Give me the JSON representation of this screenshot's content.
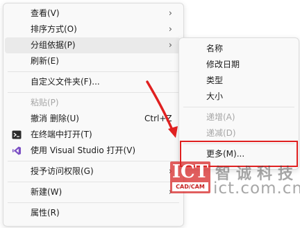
{
  "context_menu": {
    "items": [
      {
        "label": "查看(V)",
        "submenu": true
      },
      {
        "label": "排序方式(O)",
        "submenu": true
      },
      {
        "label": "分组依据(P)",
        "submenu": true,
        "highlighted": true
      },
      {
        "label": "刷新(E)"
      },
      {
        "label": "自定义文件夹(F)..."
      },
      {
        "label": "粘贴(P)",
        "disabled": true
      },
      {
        "label": "撤消 删除(U)",
        "shortcut": "Ctrl+Z"
      },
      {
        "label": "在终端中打开(T)",
        "icon": "terminal-icon"
      },
      {
        "label": "使用 Visual Studio 打开(V)",
        "icon": "visual-studio-icon"
      },
      {
        "label": "授予访问权限(G)",
        "submenu": true
      },
      {
        "label": "新建(W)",
        "submenu": true
      },
      {
        "label": "属性(R)"
      }
    ]
  },
  "group_by_submenu": {
    "items": [
      {
        "label": "名称"
      },
      {
        "label": "修改日期"
      },
      {
        "label": "类型"
      },
      {
        "label": "大小"
      },
      {
        "label": "递增(A)",
        "disabled": true
      },
      {
        "label": "递减(D)",
        "disabled": true
      },
      {
        "label": "更多(M)...",
        "emphasized": true
      }
    ]
  },
  "watermark": {
    "logo_text": "ICT",
    "logo_sub": "CAD/CAM",
    "chinese": "智诚科技",
    "url": "ict.com.cn"
  },
  "colors": {
    "menu_bg": "#f9f9f9",
    "hover_bg": "#eaeaea",
    "disabled_text": "#a6a6a6",
    "annotation_red": "#e02020"
  }
}
